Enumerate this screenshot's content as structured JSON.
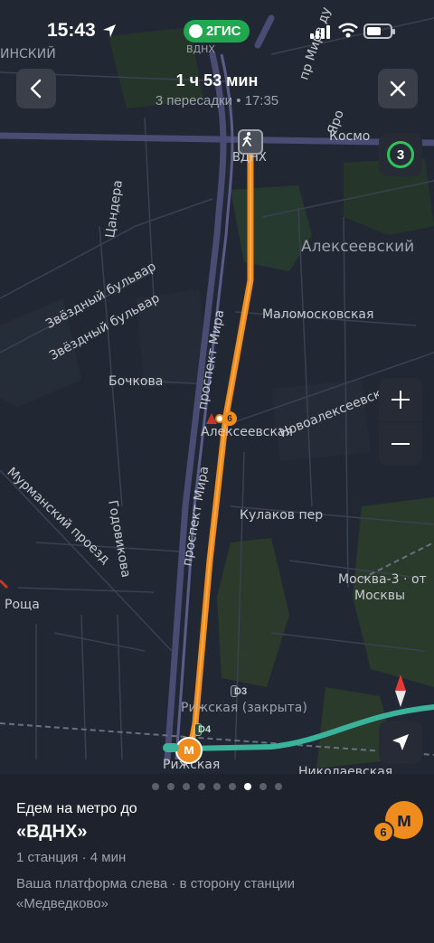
{
  "status_bar": {
    "time": "15:43",
    "brand": "2ГИС"
  },
  "route_header": {
    "title": "1 ч 53 мин",
    "subtitle": "3 пересадки • 17:35"
  },
  "map": {
    "traffic_score": "3",
    "labels": {
      "vdnkh_top": "ВДНХ",
      "vdnkh": "ВДНХ",
      "kosmo": "Космо",
      "alekseevsky": "Алексеевский",
      "tsandera": "Цандера",
      "zvezdny1": "Звёздный бульвар",
      "zvezdny2": "Звёздный бульвар",
      "prospekt_mira1": "проспект Мира",
      "prospekt_mira2": "проспект Мира",
      "malomoskovskaya": "Маломосковская",
      "bochkova": "Бочкова",
      "novoalekseevskaya": "Новоалексеевская",
      "alekseevskaya_station": "Алексеевская",
      "godovikova": "Годовикова",
      "murmansky": "Мурманский проезд",
      "kulakov": "Кулаков пер",
      "moskva3_1": "Москва-3 · от",
      "moskva3_2": "Москвы",
      "roshcha": "Роща",
      "rizhskaya_closed": "Рижская (закрыта)",
      "rizhskaya": "Рижская",
      "nikolaevskaya": "Николаевская",
      "inskiy": "ИНСКИЙ",
      "mira_du": "пр Мира ду",
      "yaro": "Яро"
    },
    "badges": {
      "d3": "D3",
      "d4": "D4",
      "line6": "6",
      "metro_m": "м"
    }
  },
  "sheet": {
    "pager_count": 9,
    "pager_active": 6,
    "line1": "Едем на метро до",
    "title": "«ВДНХ»",
    "meta": "1 станция · 4 мин",
    "note": "Ваша платформа слева · в сторону станции «Медведково»",
    "metro_letter": "м",
    "metro_line": "6"
  },
  "colors": {
    "route": "#ef8c1e",
    "metro_line": "#ef8c1e",
    "teal_route": "#3bb39b",
    "traffic_green": "#2fc45a",
    "brand": "#1fa84f"
  }
}
